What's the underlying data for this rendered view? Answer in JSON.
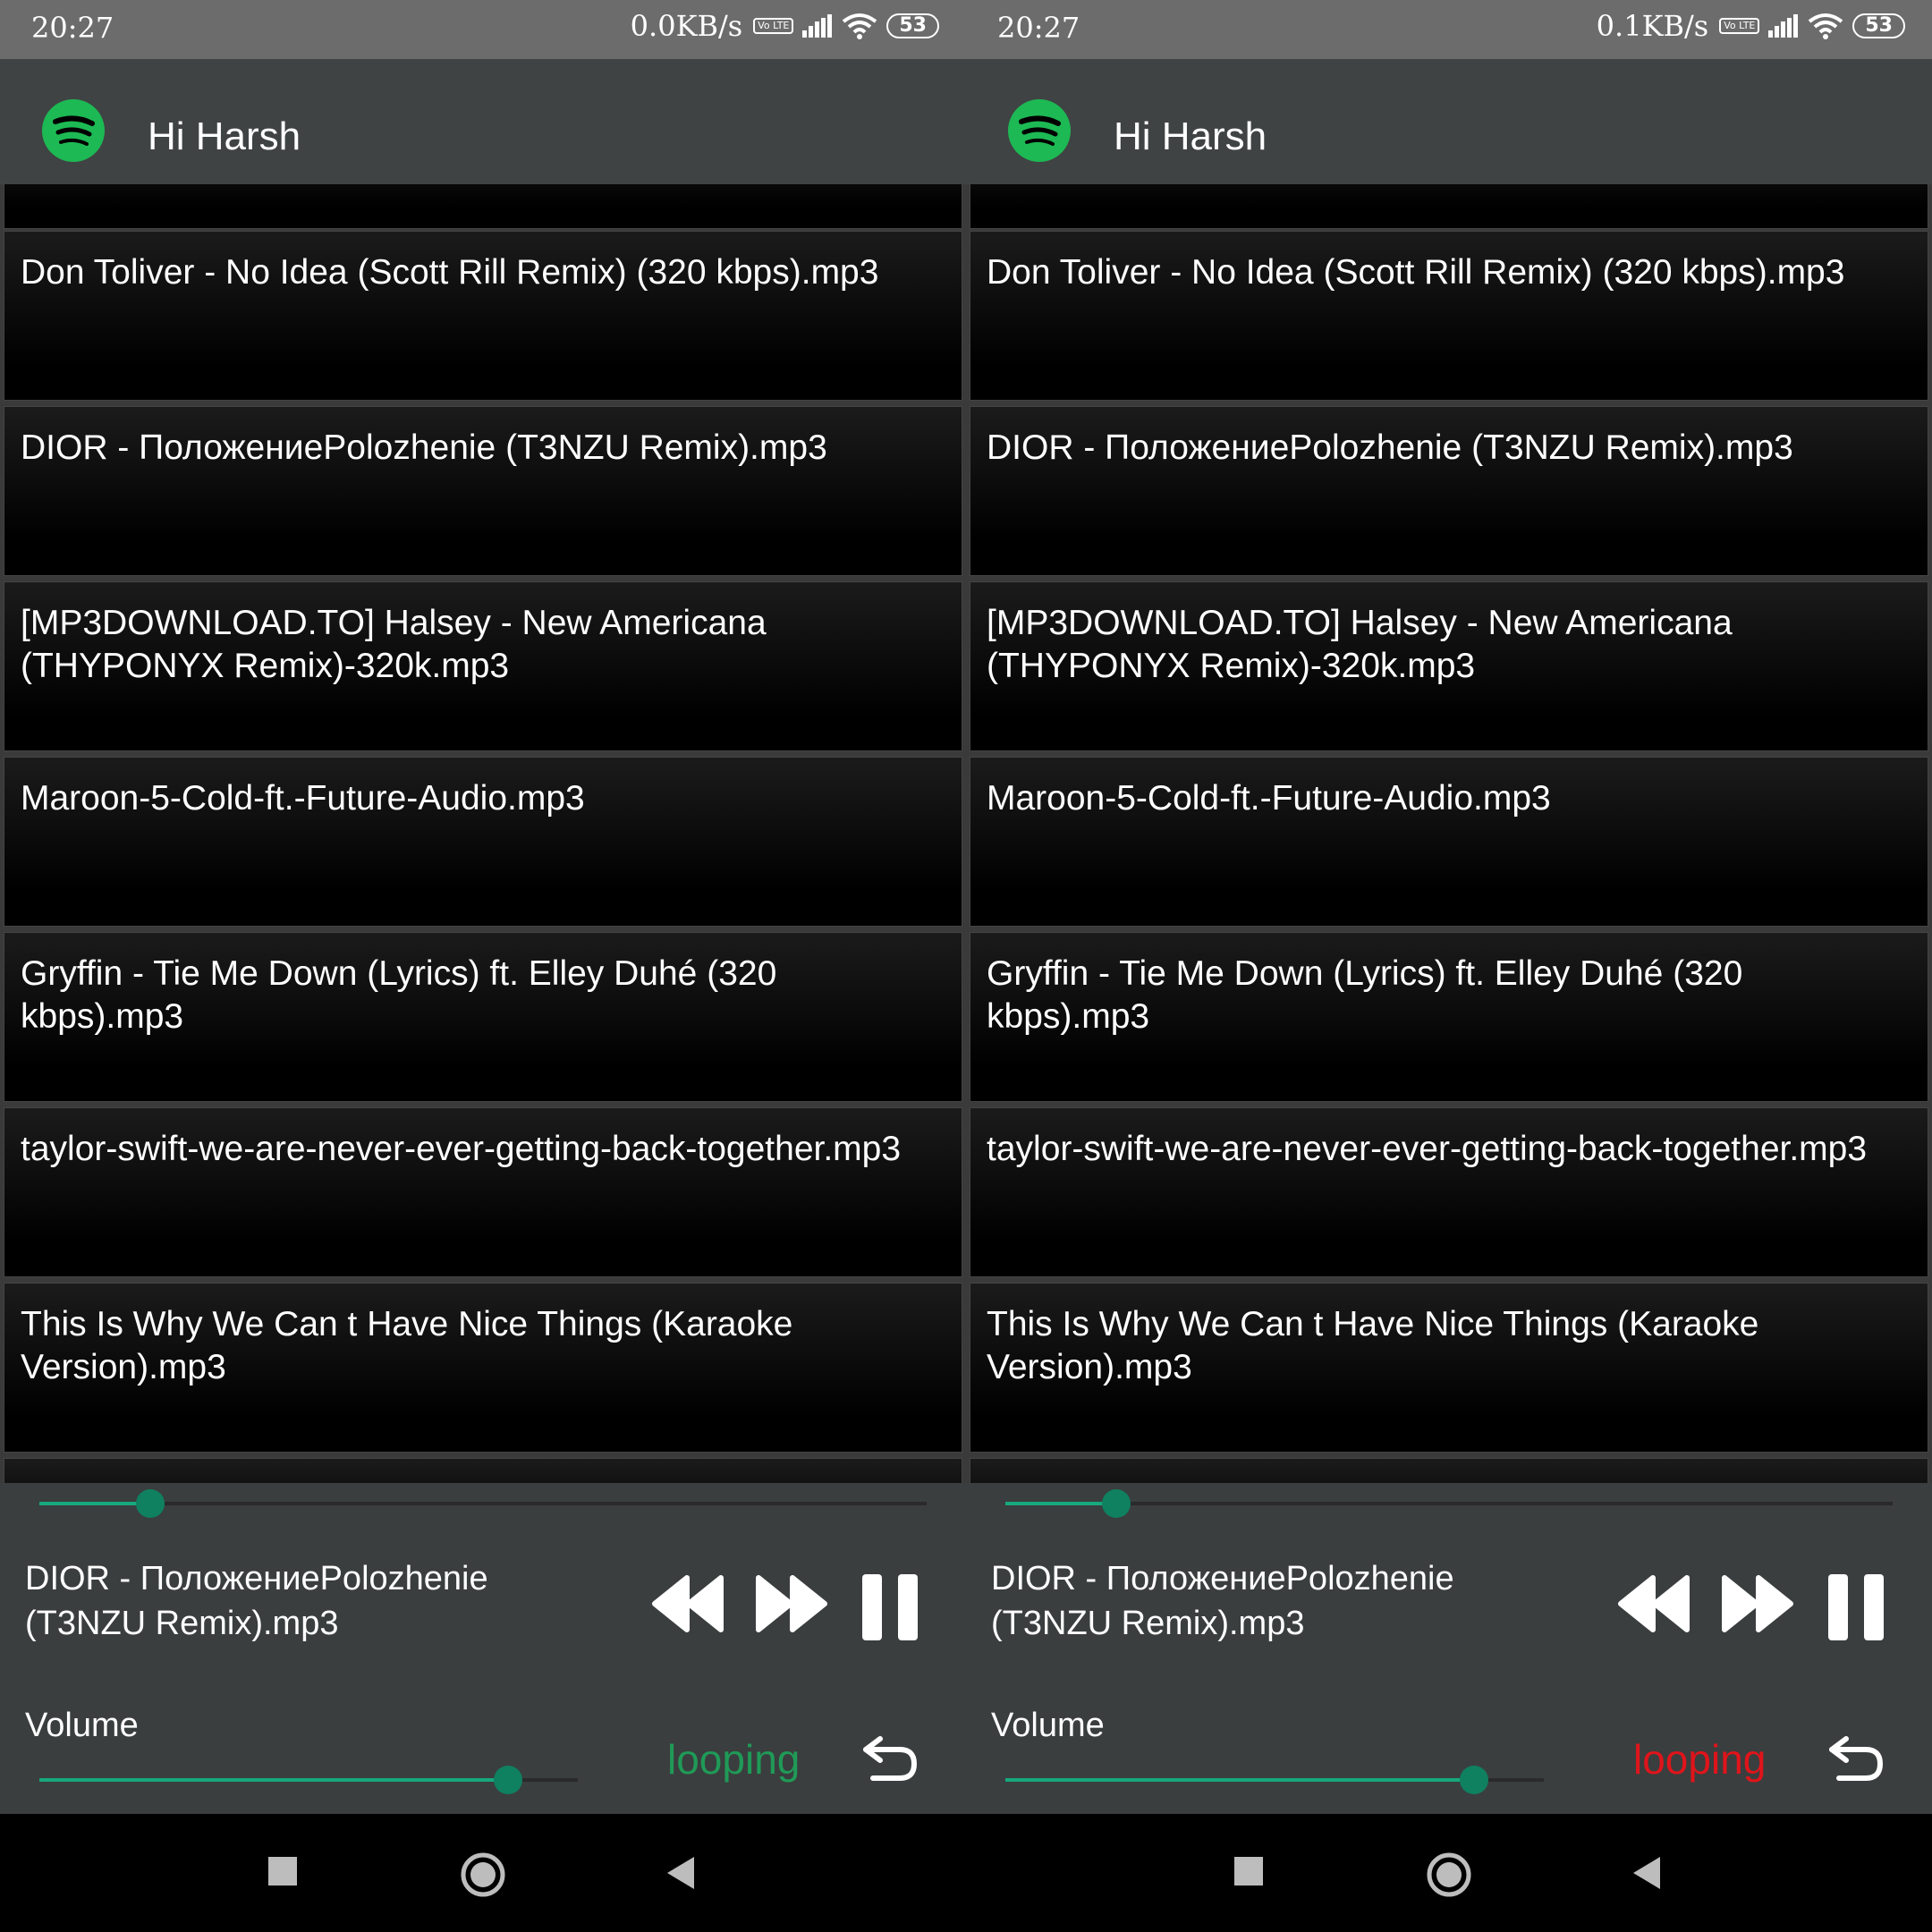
{
  "screens": [
    {
      "status": {
        "time": "20:27",
        "speed": "0.0KB/s",
        "volte": "Vo LTE",
        "battery": "53"
      },
      "app_title": "Hi Harsh",
      "songs": [
        "",
        "Don Toliver - No Idea (Scott Rill Remix) (320 kbps).mp3",
        "DIOR - ПоложениеPolozhenie (T3NZU Remix).mp3",
        "[MP3DOWNLOAD.TO] Halsey - New Americana (THYPONYX Remix)-320k.mp3",
        "Maroon-5-Cold-ft.-Future-Audio.mp3",
        "Gryffin - Tie Me Down (Lyrics) ft. Elley Duhé (320 kbps).mp3",
        "taylor-swift-we-are-never-ever-getting-back-together.mp3",
        "This Is Why We Can t Have Nice Things (Karaoke Version).mp3",
        ""
      ],
      "player": {
        "now_playing": "DIOR - ПоложениеPolozhenie (T3NZU Remix).mp3",
        "seek_progress": 0.125,
        "volume_label": "Volume",
        "volume_level": 0.87,
        "looping_label": "looping",
        "looping_color": "#1f9a57"
      }
    },
    {
      "status": {
        "time": "20:27",
        "speed": "0.1KB/s",
        "volte": "Vo LTE",
        "battery": "53"
      },
      "app_title": "Hi Harsh",
      "songs": [
        "",
        "Don Toliver - No Idea (Scott Rill Remix) (320 kbps).mp3",
        "DIOR - ПоложениеPolozhenie (T3NZU Remix).mp3",
        "[MP3DOWNLOAD.TO] Halsey - New Americana (THYPONYX Remix)-320k.mp3",
        "Maroon-5-Cold-ft.-Future-Audio.mp3",
        "Gryffin - Tie Me Down (Lyrics) ft. Elley Duhé (320 kbps).mp3",
        "taylor-swift-we-are-never-ever-getting-back-together.mp3",
        "This Is Why We Can t Have Nice Things (Karaoke Version).mp3",
        ""
      ],
      "player": {
        "now_playing": "DIOR - ПоложениеPolozhenie (T3NZU Remix).mp3",
        "seek_progress": 0.125,
        "volume_label": "Volume",
        "volume_level": 0.87,
        "looping_label": "looping",
        "looping_color": "#e0141b"
      }
    }
  ],
  "colors": {
    "accent": "#1db954",
    "slider": "#17a87d"
  },
  "icons": [
    "spotify-logo-icon",
    "rewind-icon",
    "fast-forward-icon",
    "pause-icon",
    "loop-icon",
    "wifi-icon",
    "signal-icon",
    "nav-square-icon",
    "nav-home-icon",
    "nav-back-icon"
  ]
}
